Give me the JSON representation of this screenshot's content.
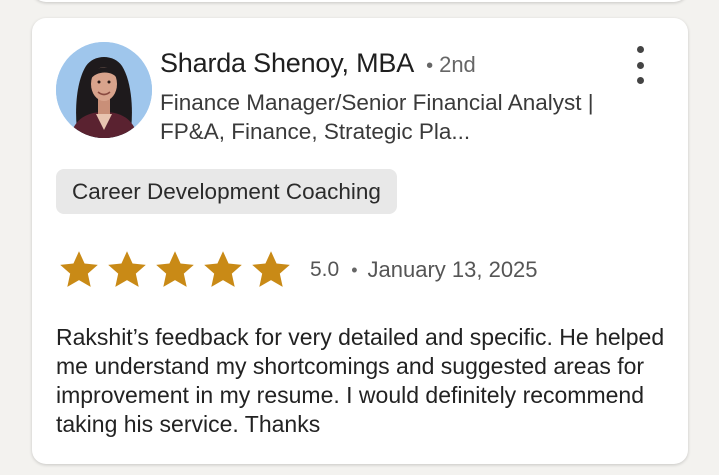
{
  "review": {
    "reviewer_name": "Sharda Shenoy, MBA",
    "connection_dot": "•",
    "connection_degree": "2nd",
    "headline": "Finance Manager/Senior Financial Analyst | FP&A, Finance, Strategic Pla...",
    "service_tag": "Career Development Coaching",
    "rating": 5.0,
    "rating_label": "5.0",
    "date_separator": "•",
    "date": "January 13, 2025",
    "text": "Rakshit’s feedback for very detailed and specific. He helped me understand my shortcomings and suggested areas for improvement in my resume. I would definitely recommend taking his service. Thanks",
    "stars_filled": 5,
    "stars_total": 5
  },
  "colors": {
    "star": "#c98a16",
    "avatar_bg": "#9fc6ec"
  },
  "icons": {
    "more": "more-vertical-icon",
    "star": "star-icon"
  }
}
